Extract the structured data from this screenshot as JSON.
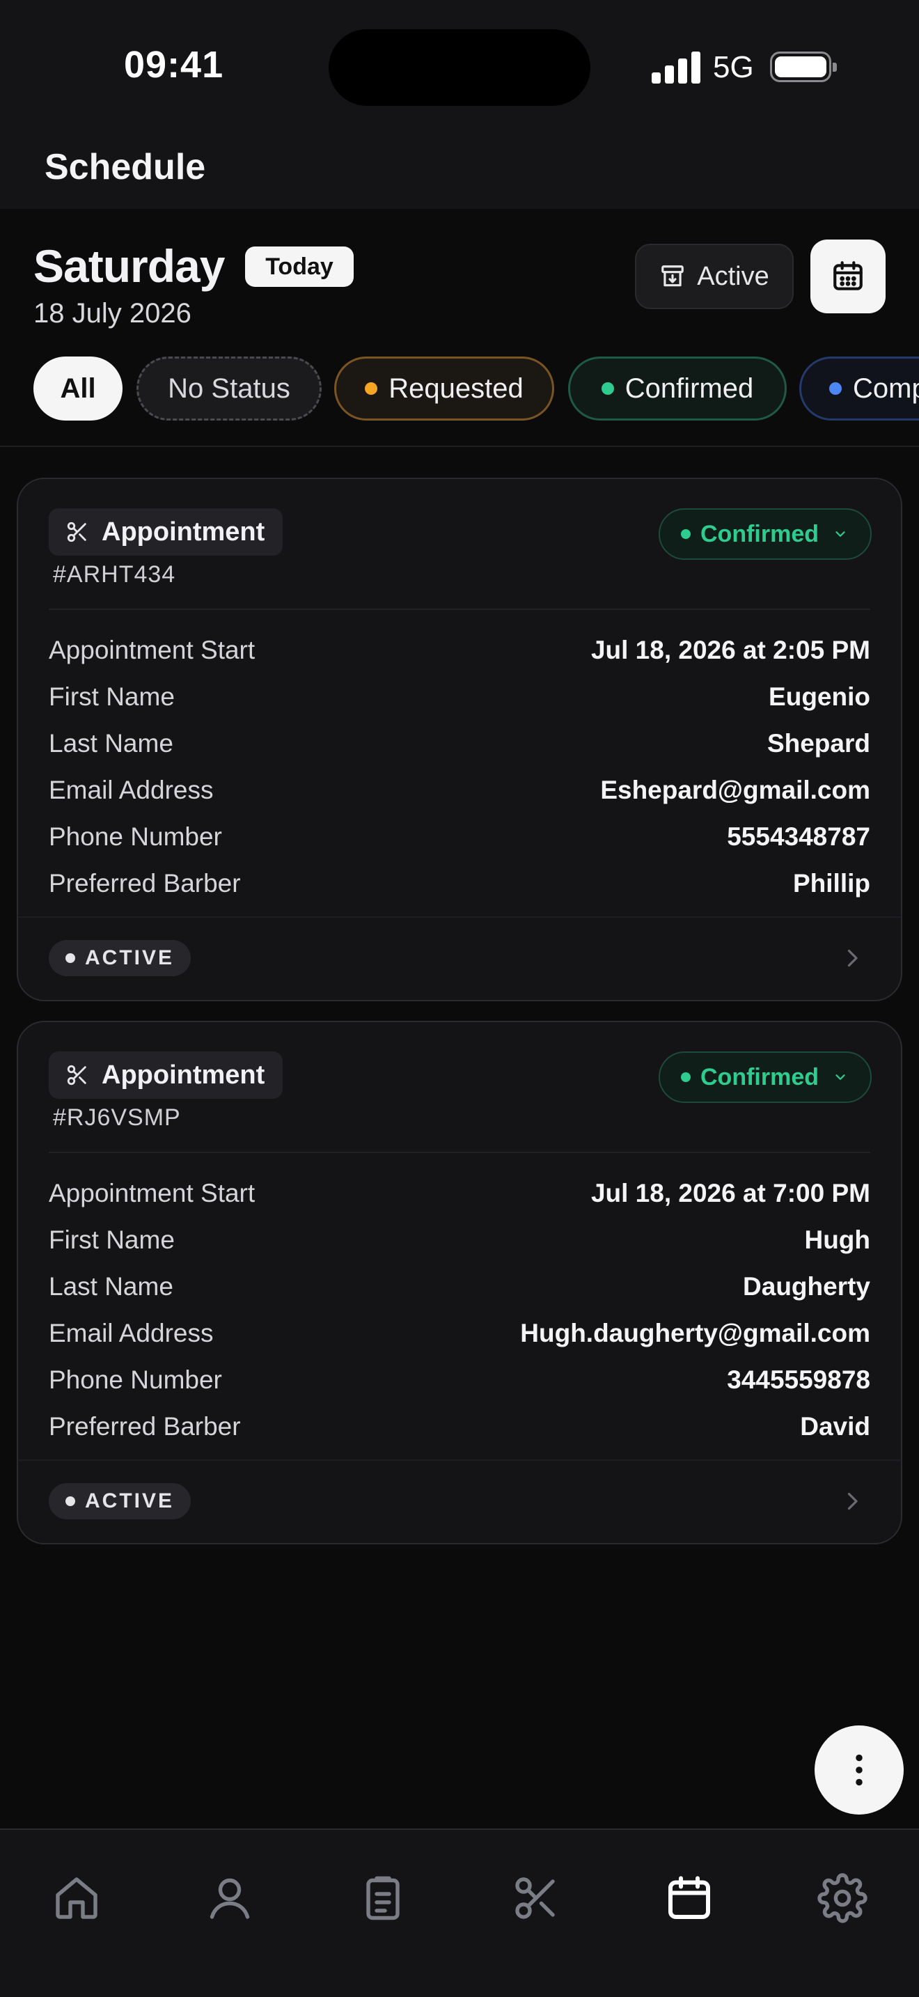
{
  "status_bar": {
    "time": "09:41",
    "network": "5G"
  },
  "app": {
    "title": "Schedule"
  },
  "day": {
    "title": "Saturday",
    "badge": "Today",
    "date": "18 July 2026"
  },
  "actions": {
    "active_toggle_label": "Active",
    "active_icon": "archive-icon",
    "calendar_icon": "calendar-icon"
  },
  "filters": {
    "all": "All",
    "no_status": "No Status",
    "requested": "Requested",
    "confirmed": "Confirmed",
    "completed": "Comp"
  },
  "colors": {
    "requested": "#f5a623",
    "confirmed": "#2ecc8f",
    "completed": "#4f86f7",
    "background": "#0b0b0c",
    "card": "#141416"
  },
  "appointments": [
    {
      "type": "Appointment",
      "id": "#ARHT434",
      "status": "Confirmed",
      "fields": [
        {
          "label": "Appointment Start",
          "value": "Jul 18, 2026 at 2:05 PM"
        },
        {
          "label": "First Name",
          "value": "Eugenio"
        },
        {
          "label": "Last Name",
          "value": "Shepard"
        },
        {
          "label": "Email Address",
          "value": "Eshepard@gmail.com"
        },
        {
          "label": "Phone Number",
          "value": "5554348787"
        },
        {
          "label": "Preferred Barber",
          "value": "Phillip"
        }
      ],
      "state": "ACTIVE"
    },
    {
      "type": "Appointment",
      "id": "#RJ6VSMP",
      "status": "Confirmed",
      "fields": [
        {
          "label": "Appointment Start",
          "value": "Jul 18, 2026 at 7:00 PM"
        },
        {
          "label": "First Name",
          "value": "Hugh"
        },
        {
          "label": "Last Name",
          "value": "Daugherty"
        },
        {
          "label": "Email Address",
          "value": "Hugh.daugherty@gmail.com"
        },
        {
          "label": "Phone Number",
          "value": "3445559878"
        },
        {
          "label": "Preferred Barber",
          "value": "David"
        }
      ],
      "state": "ACTIVE"
    }
  ],
  "nav": {
    "items": [
      {
        "icon": "home-icon"
      },
      {
        "icon": "user-icon"
      },
      {
        "icon": "clipboard-icon"
      },
      {
        "icon": "scissors-icon"
      },
      {
        "icon": "calendar-icon",
        "active": true
      },
      {
        "icon": "gear-icon"
      }
    ]
  }
}
